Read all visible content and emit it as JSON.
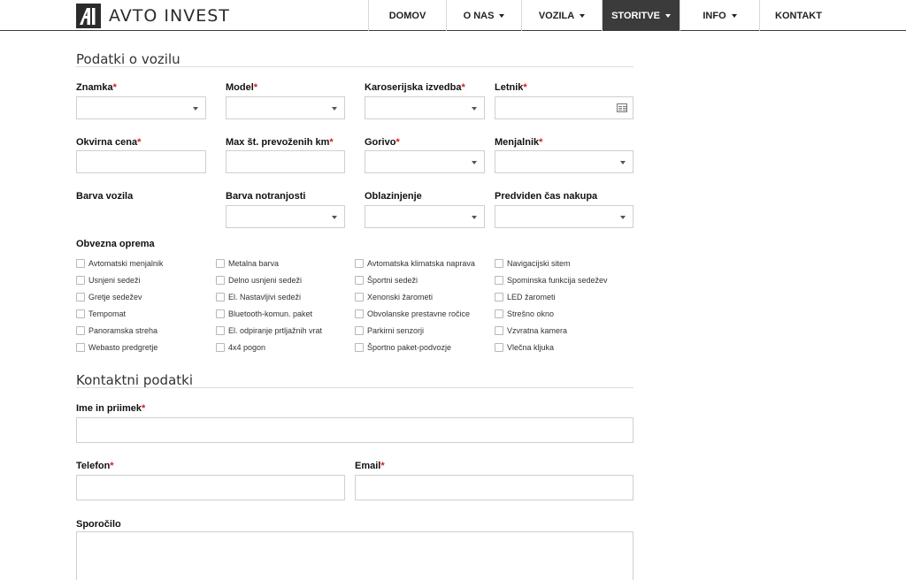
{
  "brand": {
    "name": "AVTO INVEST",
    "logo_mark": "AI"
  },
  "nav": [
    {
      "label": "DOMOV",
      "dropdown": false,
      "active": false
    },
    {
      "label": "O NAS",
      "dropdown": true,
      "active": false
    },
    {
      "label": "VOZILA",
      "dropdown": true,
      "active": false
    },
    {
      "label": "STORITVE",
      "dropdown": true,
      "active": true
    },
    {
      "label": "INFO",
      "dropdown": true,
      "active": false
    },
    {
      "label": "KONTAKT",
      "dropdown": false,
      "active": false
    }
  ],
  "vehicle": {
    "title": "Podatki o vozilu",
    "fields": [
      {
        "label": "Znamka",
        "required": true,
        "type": "select"
      },
      {
        "label": "Model",
        "required": true,
        "type": "select"
      },
      {
        "label": "Karoserijska izvedba",
        "required": true,
        "type": "select"
      },
      {
        "label": "Letnik",
        "required": true,
        "type": "date"
      },
      {
        "label": "Okvirna cena",
        "required": true,
        "type": "text"
      },
      {
        "label": "Max št. prevoženih km",
        "required": true,
        "type": "text"
      },
      {
        "label": "Gorivo",
        "required": true,
        "type": "select"
      },
      {
        "label": "Menjalnik",
        "required": true,
        "type": "select"
      },
      {
        "label": "Barva vozila",
        "required": false,
        "type": "none"
      },
      {
        "label": "Barva notranjosti",
        "required": false,
        "type": "select"
      },
      {
        "label": "Oblazinjenje",
        "required": false,
        "type": "select"
      },
      {
        "label": "Predviden čas nakupa",
        "required": false,
        "type": "select"
      }
    ],
    "equipment_label": "Obvezna oprema",
    "equipment_columns": [
      [
        "Avtomatski menjalnik",
        "Usnjeni sedeži",
        "Gretje sedežev",
        "Tempomat",
        "Panoramska streha",
        "Webasto predgretje"
      ],
      [
        "Metalna barva",
        "Delno usnjeni sedeži",
        "El. Nastavljivi sedeži",
        "Bluetooth-komun. paket",
        "El. odpiranje prtljažnih vrat",
        "4x4 pogon"
      ],
      [
        "Avtomatska klimatska naprava",
        "Športni sedeži",
        "Xenonski žarometi",
        "Obvolanske prestavne ročice",
        "Parkirni senzorji",
        "Športno paket-podvozje"
      ],
      [
        "Navigacijski sitem",
        "Spominska funkcija sedežev",
        "LED žarometi",
        "Strešno okno",
        "Vzvratna kamera",
        "Vlečna kljuka"
      ]
    ]
  },
  "contact": {
    "title": "Kontaktni podatki",
    "name_label": "Ime in priimek",
    "phone_label": "Telefon",
    "email_label": "Email",
    "message_label": "Sporočilo",
    "required_mark": "*"
  },
  "colors": {
    "active_nav_bg": "#3b3b3b",
    "required": "#d21c1c",
    "border": "#cfcfcf"
  },
  "icons": {
    "select": "chevron-down-icon",
    "date": "calendar-icon"
  }
}
